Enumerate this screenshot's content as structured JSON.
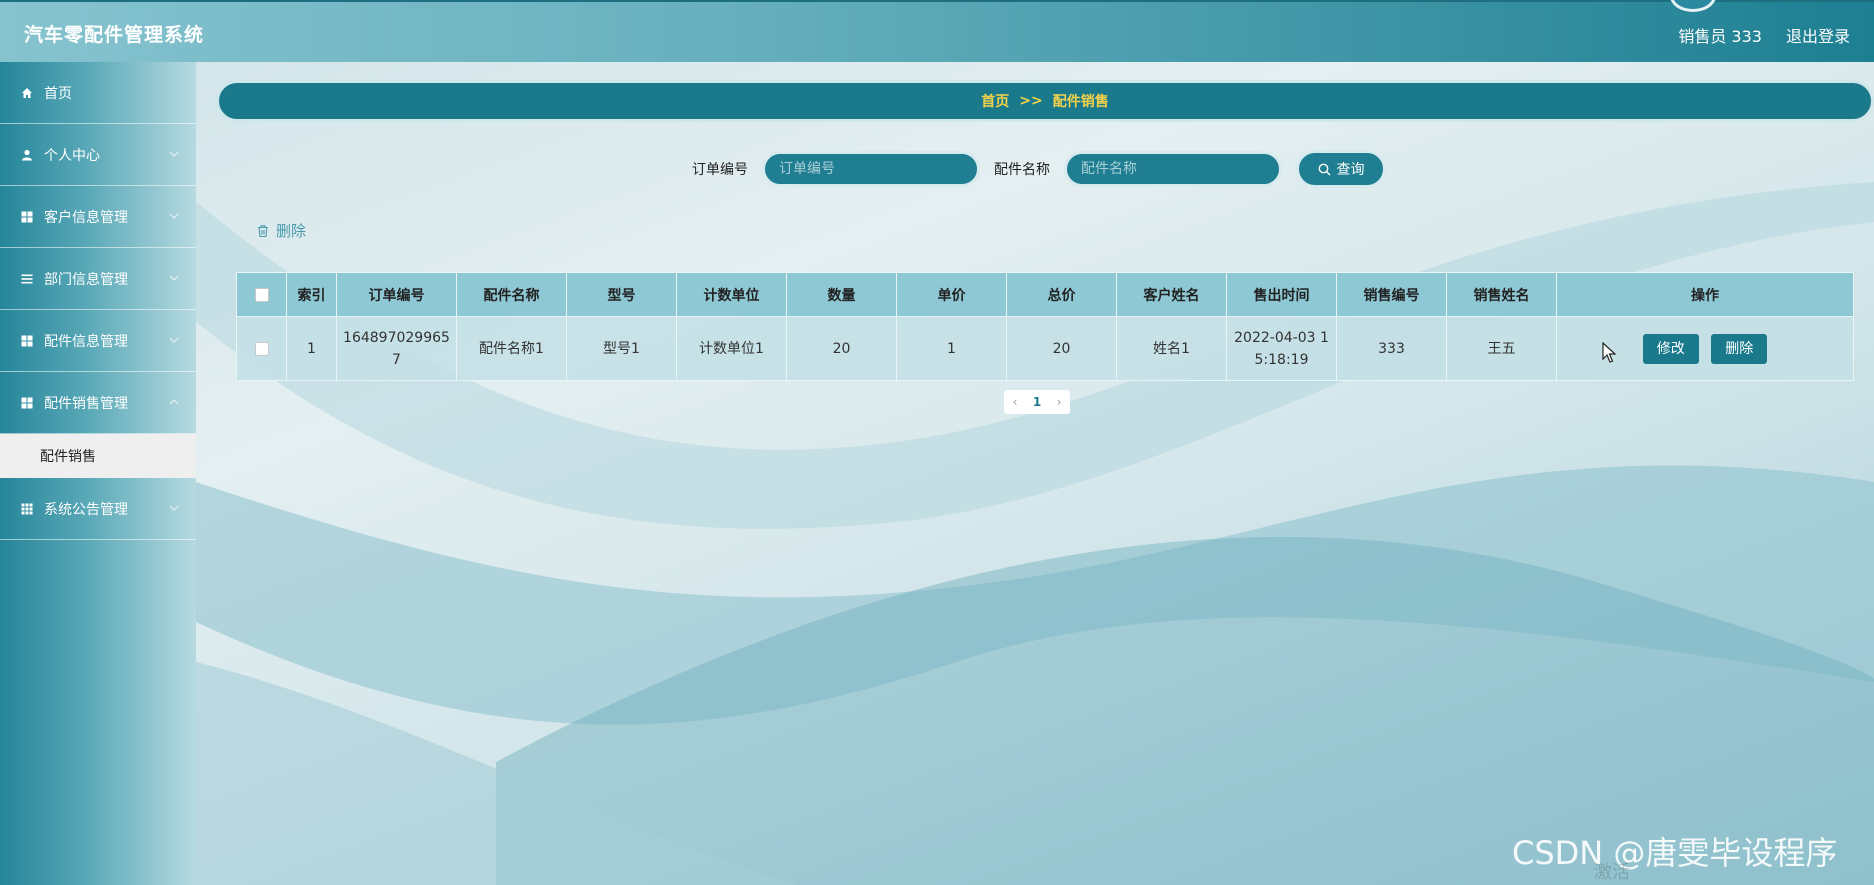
{
  "header": {
    "app_title": "汽车零配件管理系统",
    "user_label": "销售员 333",
    "logout_label": "退出登录"
  },
  "sidebar": {
    "items": [
      {
        "label": "首页",
        "icon": "home-icon"
      },
      {
        "label": "个人中心",
        "icon": "user-icon"
      },
      {
        "label": "客户信息管理",
        "icon": "grid-icon"
      },
      {
        "label": "部门信息管理",
        "icon": "list-icon"
      },
      {
        "label": "配件信息管理",
        "icon": "grid-icon"
      },
      {
        "label": "配件销售管理",
        "icon": "grid-icon"
      },
      {
        "label": "系统公告管理",
        "icon": "grid9-icon"
      }
    ],
    "active_sub_item": "配件销售"
  },
  "breadcrumb": {
    "home": "首页",
    "separator": ">>",
    "current": "配件销售"
  },
  "search": {
    "order_label": "订单编号",
    "order_placeholder": "订单编号",
    "part_label": "配件名称",
    "part_placeholder": "配件名称",
    "button_label": "查询"
  },
  "toolbar": {
    "delete_label": "删除"
  },
  "table": {
    "columns": [
      "索引",
      "订单编号",
      "配件名称",
      "型号",
      "计数单位",
      "数量",
      "单价",
      "总价",
      "客户姓名",
      "售出时间",
      "销售编号",
      "销售姓名",
      "操作"
    ],
    "rows": [
      {
        "index": "1",
        "order_no_line1": "164897029965",
        "order_no_line2": "7",
        "part_name": "配件名称1",
        "model": "型号1",
        "unit": "计数单位1",
        "quantity": "20",
        "unit_price": "1",
        "total": "20",
        "customer": "姓名1",
        "sold_time_line1": "2022-04-03 1",
        "sold_time_line2": "5:18:19",
        "sales_no": "333",
        "sales_name": "王五",
        "edit_label": "修改",
        "delete_label": "删除"
      }
    ]
  },
  "pagination": {
    "prev": "‹",
    "current_page": "1",
    "next": "›"
  },
  "overlay": {
    "watermark": "CSDN @唐雯毕设程序",
    "activate_hint": "激活"
  },
  "colors": {
    "primary": "#1a7a8c",
    "breadcrumb_text": "#f5d24a",
    "header_gradient_end": "#1d7f92",
    "table_header": "#8ec8d4"
  }
}
